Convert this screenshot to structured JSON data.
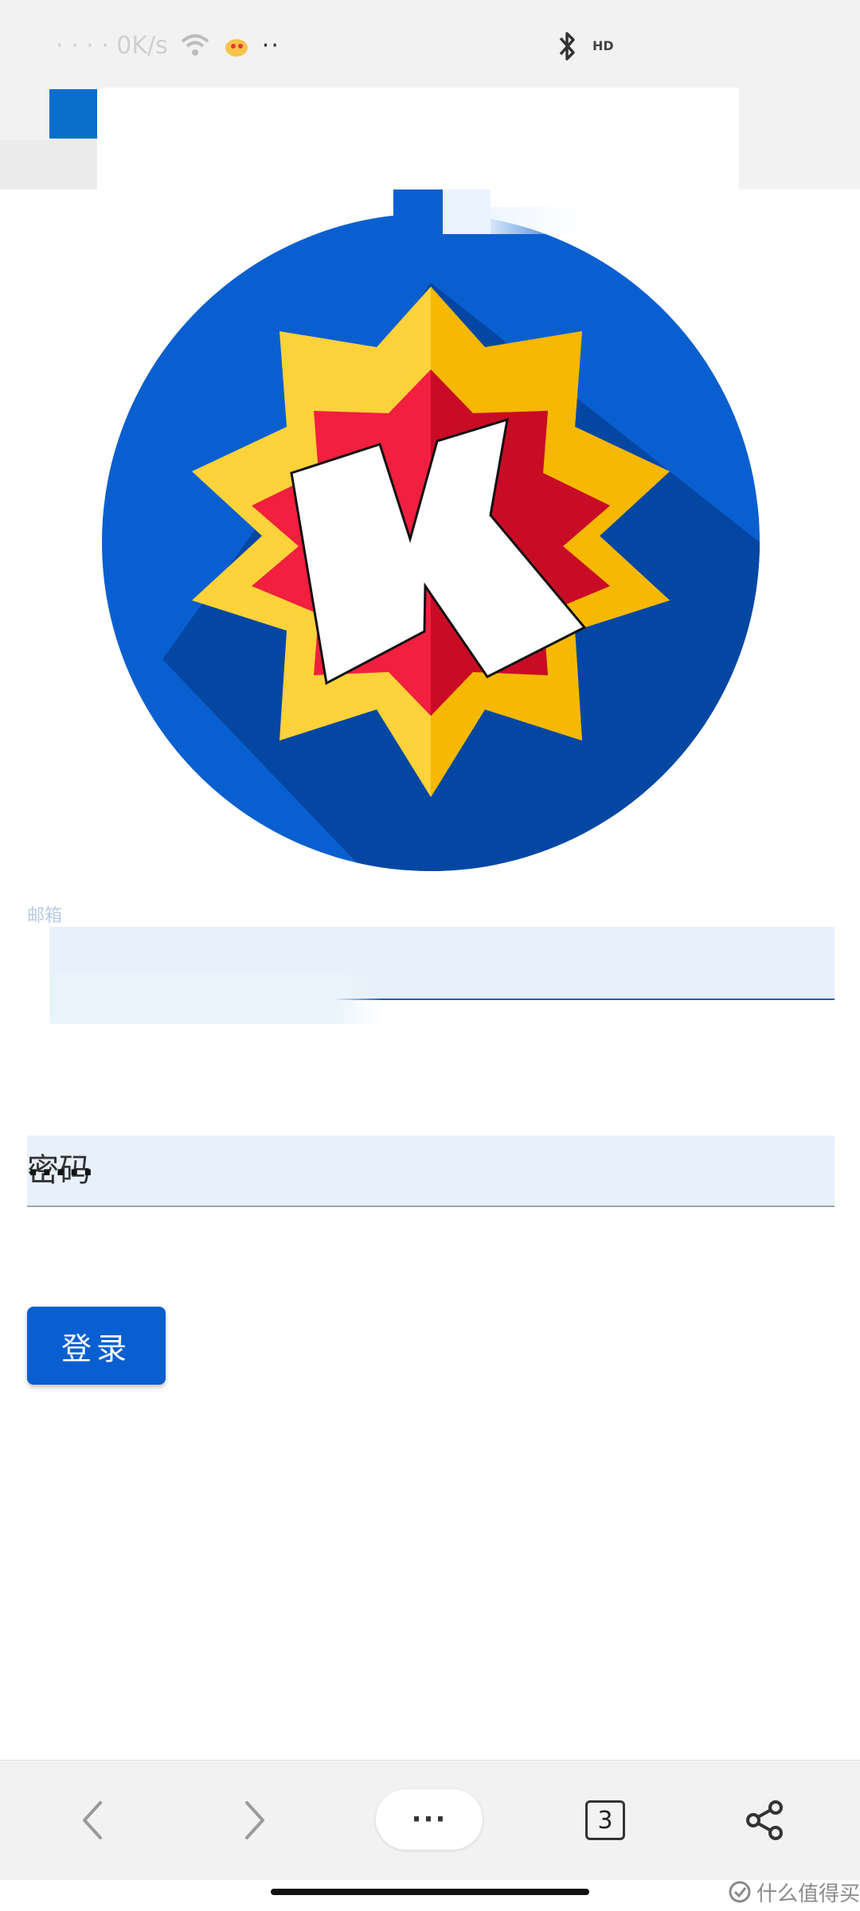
{
  "status_bar": {
    "left_text": "· · · · 0K/s",
    "dots": "··",
    "hd": "HD"
  },
  "logo": {
    "letter": "K",
    "colors": {
      "circle": "#0a5fd0",
      "circle_shadow": "#0447a3",
      "star_outer": "#fdd23a",
      "star_outer_shadow": "#f6b800",
      "star_inner": "#f21f3f",
      "star_inner_shadow": "#c90c26",
      "letter_fill": "#ffffff"
    }
  },
  "form": {
    "email_label": "邮箱",
    "password_label": "密码",
    "password_value": "·····",
    "login_label": "登录"
  },
  "toolbar": {
    "back_icon": "chevron-left-icon",
    "forward_icon": "chevron-right-icon",
    "menu_label": "···",
    "tab_count": "3",
    "share_icon": "share-icon"
  },
  "watermark": {
    "text": "什么值得买"
  }
}
